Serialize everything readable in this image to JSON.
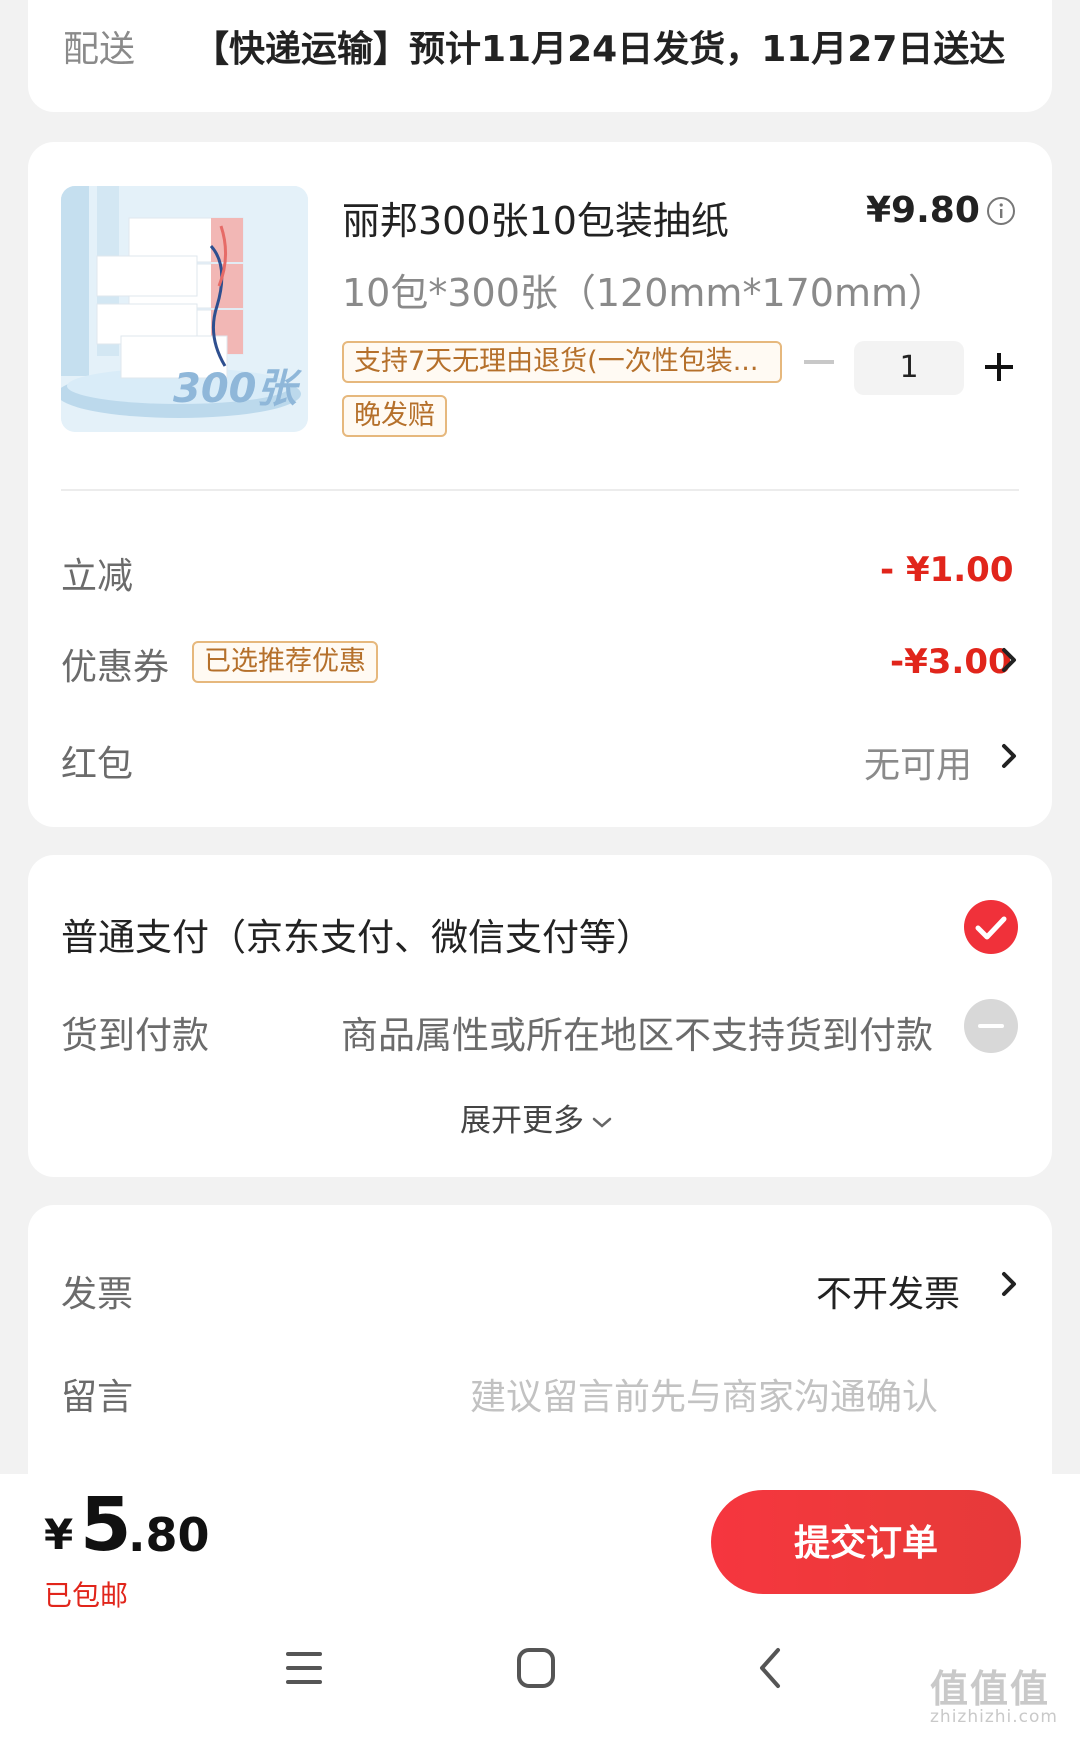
{
  "delivery": {
    "label": "配送",
    "text": "【快递运输】预计11月24日发货，11月27日送达"
  },
  "product": {
    "title": "丽邦300张10包装抽纸",
    "price": "¥9.80",
    "spec": "10包*300张（120mm*170mm）",
    "tags": [
      "支持7天无理由退货(一次性包装...",
      "晚发赔"
    ],
    "quantity": "1",
    "image_text": "300张"
  },
  "discounts": {
    "instant": {
      "label": "立减",
      "value": "- ¥1.00"
    },
    "coupon": {
      "label": "优惠券",
      "badge": "已选推荐优惠",
      "value": "-¥3.00"
    },
    "redpacket": {
      "label": "红包",
      "value": "无可用"
    }
  },
  "payment": {
    "normal": "普通支付（京东支付、微信支付等）",
    "cod_label": "货到付款",
    "cod_note": "商品属性或所在地区不支持货到付款",
    "expand": "展开更多"
  },
  "invoice": {
    "label": "发票",
    "value": "不开发票"
  },
  "message": {
    "label": "留言",
    "placeholder": "建议留言前先与商家沟通确认"
  },
  "footer": {
    "currency": "¥",
    "total_int": "5",
    "total_dec": ".80",
    "shipping": "已包邮",
    "submit": "提交订单"
  },
  "watermark": {
    "main": "值值值",
    "sub": "zhizhizhi.com"
  },
  "colors": {
    "accent_red": "#e1251b",
    "tag_border": "#e6b87d",
    "background": "#f2f2f2"
  },
  "icons": [
    "info-icon",
    "minus-icon",
    "plus-icon",
    "chevron-right-icon",
    "check-circle-icon",
    "disabled-circle-icon",
    "chevron-down-icon",
    "menu-icon",
    "home-icon",
    "back-icon"
  ]
}
